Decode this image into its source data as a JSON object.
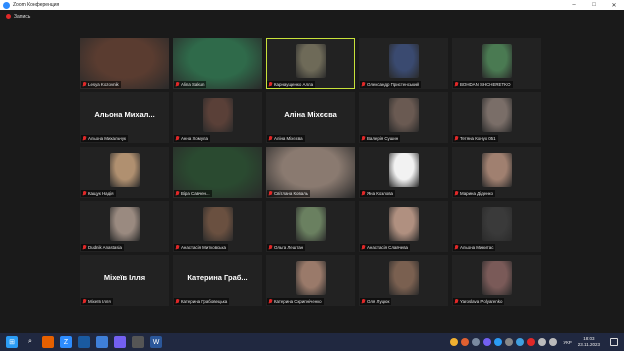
{
  "window": {
    "title": "Zoom Конференция"
  },
  "toolbar": {
    "recording_label": "Запись"
  },
  "participants": [
    {
      "name": "Lesya Kozovnik",
      "big": "",
      "tone": "#5a3c30",
      "wide": true,
      "active": false
    },
    {
      "name": "Alina Sakun",
      "big": "",
      "tone": "#2f6a4a",
      "wide": true,
      "active": false
    },
    {
      "name": "Карнаущенко Алла",
      "big": "",
      "tone": "#6e6a58",
      "wide": false,
      "active": true
    },
    {
      "name": "Олександр Пристенський",
      "big": "",
      "tone": "#3a4a70",
      "wide": false,
      "active": false
    },
    {
      "name": "BOHDAN SHCHERETKO",
      "big": "",
      "tone": "#4a7a52",
      "wide": false,
      "active": false
    },
    {
      "name": "Альона Михальчук",
      "big": "Альона Михал...",
      "tone": "",
      "wide": false,
      "active": false
    },
    {
      "name": "Анна Хомула",
      "big": "",
      "tone": "#5a4038",
      "wide": false,
      "active": false
    },
    {
      "name": "Аліна Міхєєва",
      "big": "Аліна Міхєєва",
      "tone": "",
      "wide": false,
      "active": false
    },
    {
      "name": "Валерія Сушин",
      "big": "",
      "tone": "#6a5a52",
      "wide": false,
      "active": false
    },
    {
      "name": "Тетяна Конух 051",
      "big": "",
      "tone": "#7a6e68",
      "wide": false,
      "active": false
    },
    {
      "name": "Кащук Надія",
      "big": "",
      "tone": "#b09070",
      "wide": false,
      "active": false
    },
    {
      "name": "Віра Савчен...",
      "big": "",
      "tone": "#2a4a30",
      "wide": true,
      "active": false
    },
    {
      "name": "Світлана Коваль",
      "big": "",
      "tone": "#8a7a70",
      "wide": true,
      "active": false
    },
    {
      "name": "Яна Козлова",
      "big": "",
      "tone": "#f2f2f2",
      "wide": false,
      "active": false
    },
    {
      "name": "Марина Діденко",
      "big": "",
      "tone": "#a08070",
      "wide": false,
      "active": false
    },
    {
      "name": "Dudnik Anastasia",
      "big": "",
      "tone": "#9a8a80",
      "wide": false,
      "active": false
    },
    {
      "name": "Анастасія Митковська",
      "big": "",
      "tone": "#6a5040",
      "wide": false,
      "active": false
    },
    {
      "name": "Ольга Лештан",
      "big": "",
      "tone": "#6a8060",
      "wide": false,
      "active": false
    },
    {
      "name": "Анастасія Славчева",
      "big": "",
      "tone": "#b09080",
      "wide": false,
      "active": false
    },
    {
      "name": "Альона Микитас",
      "big": "",
      "tone": "#3a3a3a",
      "wide": false,
      "active": false
    },
    {
      "name": "Міхеїв Ілля",
      "big": "Міхеїв Ілля",
      "tone": "",
      "wide": false,
      "active": false
    },
    {
      "name": "Катерина Грабовецька",
      "big": "Катерина Граб...",
      "tone": "",
      "wide": false,
      "active": false
    },
    {
      "name": "Катерина Скрипніченко",
      "big": "",
      "tone": "#9a7a6a",
      "wide": false,
      "active": false
    },
    {
      "name": "Оля Луцюк",
      "big": "",
      "tone": "#7a6050",
      "wide": false,
      "active": false
    },
    {
      "name": "Yaroslava Polyarenko",
      "big": "",
      "tone": "#7a5a58",
      "wide": false,
      "active": false
    }
  ],
  "taskbar": {
    "apps": [
      {
        "icon": "windows-start-icon",
        "color": "#2b9cf5",
        "glyph": "⊞"
      },
      {
        "icon": "search-icon",
        "color": "transparent",
        "glyph": "⌕"
      },
      {
        "icon": "firefox-icon",
        "color": "#e66000",
        "glyph": ""
      },
      {
        "icon": "zoom-icon",
        "color": "#2d8cff",
        "glyph": "Z"
      },
      {
        "icon": "app-icon",
        "color": "#1a5aa0",
        "glyph": ""
      },
      {
        "icon": "app-icon",
        "color": "#3f7fd8",
        "glyph": ""
      },
      {
        "icon": "viber-icon",
        "color": "#7360f2",
        "glyph": ""
      },
      {
        "icon": "app-icon",
        "color": "#555",
        "glyph": ""
      },
      {
        "icon": "word-icon",
        "color": "#2b579a",
        "glyph": "W"
      }
    ],
    "language": "УКР",
    "time": "18:03",
    "date": "23.11.2023"
  }
}
